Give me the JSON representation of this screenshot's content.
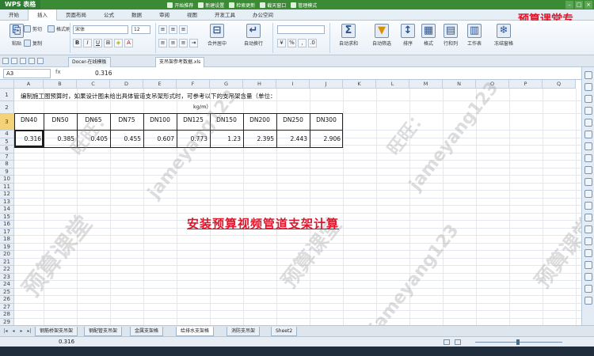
{
  "window": {
    "app_name": "WPS 表格",
    "tabs": [
      "开始推荐",
      "新建设置",
      "检索更新",
      "截天窗口",
      "管理模式"
    ]
  },
  "menu": {
    "items": [
      "开始",
      "插入",
      "页面布局",
      "公式",
      "数据",
      "审阅",
      "视图",
      "开发工具",
      "办公空间"
    ],
    "active": 1
  },
  "ribbon": {
    "cut": "剪切",
    "copy": "复制",
    "format_painter": "格式刷",
    "paste": "粘贴",
    "font_name": "宋体",
    "font_size": "12",
    "bold": "B",
    "italic": "I",
    "underline": "U",
    "merge_center": "合并居中",
    "wrap_text": "自动换行",
    "autosum": "自动求和",
    "autofilter": "自动筛选",
    "sort": "排序",
    "format": "格式",
    "row_col": "行和列",
    "worksheet": "工作表",
    "freeze": "冻结窗格"
  },
  "doc_tabs": [
    "Docer-在线模板",
    "支吊架参考数据.xls"
  ],
  "formula_bar": {
    "cell_ref": "A3",
    "fx_label": "fx",
    "value": "0.316"
  },
  "columns": [
    "A",
    "B",
    "C",
    "D",
    "E",
    "F",
    "G",
    "H",
    "I",
    "J",
    "K",
    "L",
    "M",
    "N",
    "O",
    "P",
    "Q"
  ],
  "rows": [
    "1",
    "2",
    "3",
    "4",
    "5",
    "6",
    "7",
    "8",
    "9",
    "10",
    "11",
    "12",
    "13",
    "14",
    "15",
    "16",
    "17",
    "18",
    "19",
    "20",
    "21",
    "22",
    "23",
    "24",
    "25",
    "26",
    "27",
    "28",
    "29"
  ],
  "sheet": {
    "row1_text": "编制施工图预算时，如果设计图未给出具体管道支吊架形式时，可参考以下的支吊架含量（单位：",
    "row1_unit": "kg/m）",
    "headers": [
      "DN40",
      "DN50",
      "DN65",
      "DN75",
      "DN100",
      "DN125",
      "DN150",
      "DN200",
      "DN250",
      "DN300"
    ],
    "values": [
      "0.316",
      "0.385",
      "0.405",
      "0.455",
      "0.607",
      "0.773",
      "1.23",
      "2.395",
      "2.443",
      "2.906"
    ]
  },
  "overlay": {
    "title": "安装预算视频管道支架计算",
    "watermark_1": "预算课堂",
    "watermark_2": "旺旺：",
    "watermark_3": "jameyang123",
    "top_right_red": "预算课堂专"
  },
  "sheet_tabs": [
    "钢筋桥架支吊架",
    "钢配管支吊架",
    "金属支架格",
    "给排水支架格",
    "消防支吊架",
    "Sheet2"
  ],
  "status": {
    "value": "0.316"
  }
}
